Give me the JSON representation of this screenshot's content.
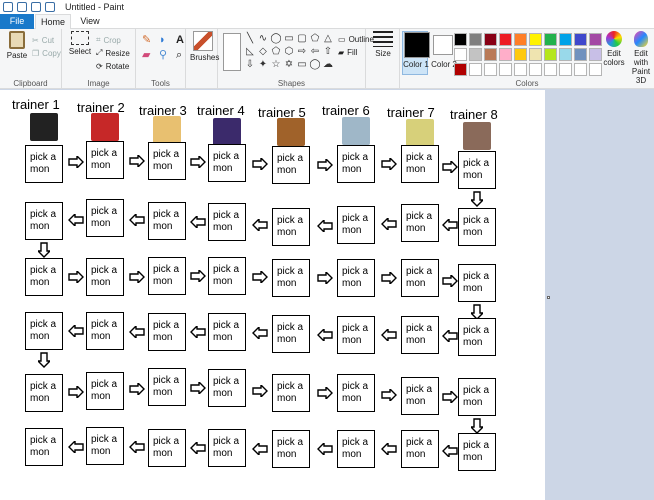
{
  "window": {
    "title": "Untitled - Paint"
  },
  "tabs": [
    "File",
    "Home",
    "View"
  ],
  "ribbon": {
    "clipboard": {
      "label": "Clipboard",
      "paste": "Paste",
      "cut": "Cut",
      "copy": "Copy"
    },
    "image": {
      "label": "Image",
      "select": "Select",
      "crop": "Crop",
      "resize": "Resize",
      "rotate": "Rotate"
    },
    "tools": {
      "label": "Tools"
    },
    "brushes": {
      "label": "Brushes"
    },
    "shapes": {
      "label": "Shapes",
      "outline": "Outline",
      "fill": "Fill"
    },
    "size": {
      "label": "Size"
    },
    "colors": {
      "label": "Colors",
      "color1": "Color 1",
      "color2": "Color 2",
      "edit": "Edit colors",
      "paint3d": "Edit with Paint 3D",
      "color1_value": "#000000",
      "color2_value": "#ffffff",
      "palette": [
        "#000000",
        "#7f7f7f",
        "#880015",
        "#ed1c24",
        "#ff7f27",
        "#fff200",
        "#22b14c",
        "#00a2e8",
        "#3f48cc",
        "#a349a4",
        "#ffffff",
        "#c3c3c3",
        "#b97a57",
        "#ffaec9",
        "#ffc90e",
        "#efe4b0",
        "#b5e61d",
        "#99d9ea",
        "#7092be",
        "#c8bfe7",
        "#b00000",
        "#ffffff",
        "#ffffff",
        "#ffffff",
        "#ffffff",
        "#ffffff",
        "#ffffff",
        "#ffffff",
        "#ffffff",
        "#ffffff"
      ]
    }
  },
  "canvas": {
    "trainers": [
      "trainer 1",
      "trainer 2",
      "trainer 3",
      "trainer 4",
      "trainer 5",
      "trainer 6",
      "trainer 7",
      "trainer 8"
    ],
    "box_label": "pick a\nmon",
    "avatar_colors": [
      "#222222",
      "#c62828",
      "#e8c070",
      "#3b2a6b",
      "#a0622a",
      "#9fb7c8",
      "#d7d07a",
      "#8a6a5a"
    ]
  }
}
